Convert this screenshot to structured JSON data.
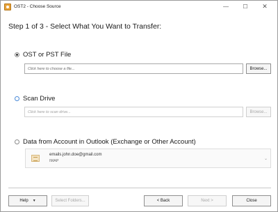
{
  "window": {
    "title": "OST2 - Choose Source",
    "minimize_glyph": "—",
    "maximize_glyph": "☐",
    "close_glyph": "✕"
  },
  "heading": "Step 1 of 3 - Select What You Want to Transfer:",
  "options": {
    "ost_pst": {
      "label": "OST or PST File",
      "selected": true,
      "input_placeholder": "Click here to choose a file...",
      "browse_label": "Browse..."
    },
    "scan_drive": {
      "label": "Scan Drive",
      "selected": false,
      "input_placeholder": "Click here to scan drive...",
      "browse_label": "Browse..."
    },
    "account": {
      "label": "Data from Account in Outlook (Exchange or Other Account)",
      "selected": false,
      "email": "emails.john.doe@gmail.com",
      "type": "IMAP"
    }
  },
  "footer": {
    "help_label": "Help",
    "help_chevron": "▼",
    "select_folders_label": "Select Folders...",
    "back_label": "< Back",
    "next_label": "Next >",
    "close_label": "Close"
  },
  "icons": {
    "app": "app-icon",
    "account": "account-icon",
    "dropdown": "chevron-down-icon"
  }
}
